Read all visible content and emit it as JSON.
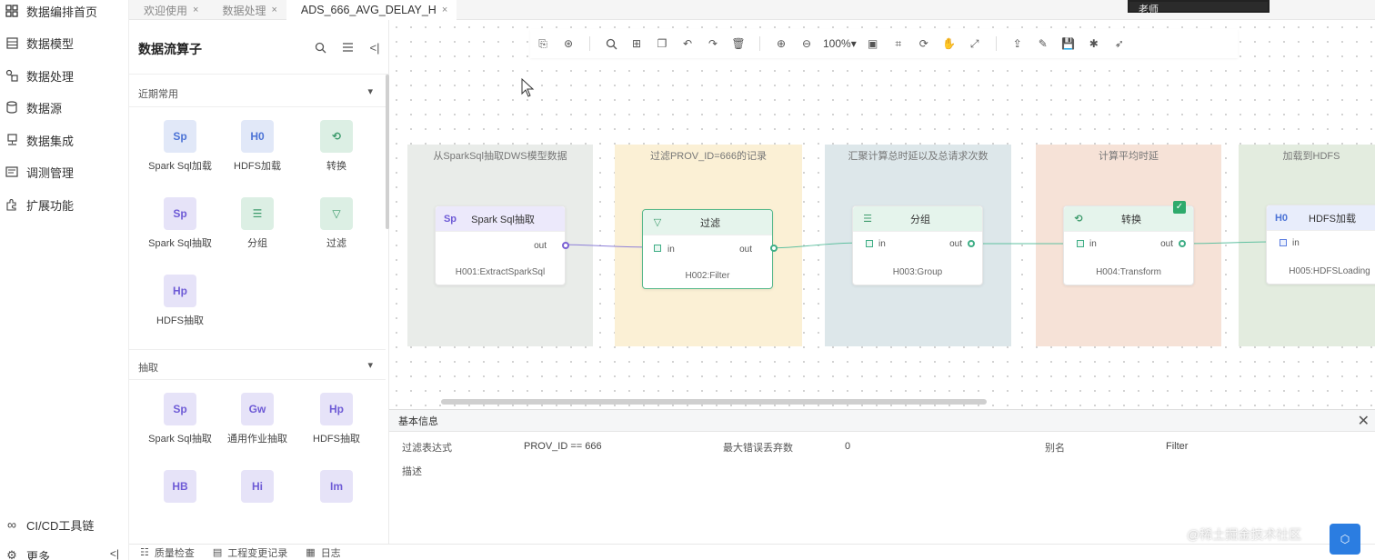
{
  "nav": {
    "items": [
      {
        "label": "数据编排首页",
        "icon": "grid-icon"
      },
      {
        "label": "数据模型",
        "icon": "model-icon"
      },
      {
        "label": "数据处理",
        "icon": "process-icon"
      },
      {
        "label": "数据源",
        "icon": "database-icon"
      },
      {
        "label": "数据集成",
        "icon": "integration-icon"
      },
      {
        "label": "调测管理",
        "icon": "debug-icon"
      },
      {
        "label": "扩展功能",
        "icon": "extension-icon"
      }
    ],
    "cicd_label": "CI/CD工具链",
    "more_label": "更多"
  },
  "tabs": [
    {
      "label": "欢迎使用",
      "active": false
    },
    {
      "label": "数据处理",
      "active": false
    },
    {
      "label": "ADS_666_AVG_DELAY_H",
      "active": true
    }
  ],
  "tab_close_glyph": "×",
  "panel": {
    "title": "数据流算子",
    "sections": [
      {
        "title": "近期常用",
        "items": [
          {
            "label": "Spark Sql加载",
            "icon_text": "Sp"
          },
          {
            "label": "HDFS加载",
            "icon_text": "H0"
          },
          {
            "label": "转换",
            "icon_text": "⟲"
          },
          {
            "label": "Spark Sql抽取",
            "icon_text": "Sp"
          },
          {
            "label": "分组",
            "icon_text": "☰"
          },
          {
            "label": "过滤",
            "icon_text": "▽"
          },
          {
            "label": "HDFS抽取",
            "icon_text": "Hp"
          }
        ]
      },
      {
        "title": "抽取",
        "items": [
          {
            "label": "Spark Sql抽取",
            "icon_text": "Sp"
          },
          {
            "label": "通用作业抽取",
            "icon_text": "Gw"
          },
          {
            "label": "HDFS抽取",
            "icon_text": "Hp"
          },
          {
            "label": "",
            "icon_text": "HB"
          },
          {
            "label": "",
            "icon_text": "Hi"
          },
          {
            "label": "",
            "icon_text": "Im"
          }
        ]
      }
    ]
  },
  "toolbar": {
    "zoom": "100%▾"
  },
  "stages": [
    {
      "title": "从SparkSql抽取DWS模型数据",
      "color": "#e9ece9"
    },
    {
      "title": "过滤PROV_ID=666的记录",
      "color": "#fbf0d5"
    },
    {
      "title": "汇聚计算总时延以及总请求次数",
      "color": "#dde7ea"
    },
    {
      "title": "计算平均时延",
      "color": "#f6e2d7"
    },
    {
      "title": "加载到HDFS",
      "color": "#e3ecdf"
    }
  ],
  "nodes": [
    {
      "title": "Spark Sql抽取",
      "icon_text": "Sp",
      "in_label": "",
      "out_label": "out",
      "id_label": "H001:ExtractSparkSql"
    },
    {
      "title": "过滤",
      "icon_text": "▽",
      "in_label": "in",
      "out_label": "out",
      "id_label": "H002:Filter"
    },
    {
      "title": "分组",
      "icon_text": "☰",
      "in_label": "in",
      "out_label": "out",
      "id_label": "H003:Group"
    },
    {
      "title": "转换",
      "icon_text": "⟲",
      "in_label": "in",
      "out_label": "out",
      "id_label": "H004:Transform"
    },
    {
      "title": "HDFS加载",
      "icon_text": "H0",
      "in_label": "in",
      "out_label": "",
      "id_label": "H005:HDFSLoading"
    }
  ],
  "props": {
    "title": "基本信息",
    "filter_expr_label": "过滤表达式",
    "filter_expr_value": "PROV_ID == 666",
    "max_error_label": "最大错误丢弃数",
    "max_error_value": "0",
    "alias_label": "别名",
    "alias_value": "Filter",
    "desc_label": "描述",
    "close_glyph": "✕"
  },
  "bottombar": {
    "items": [
      "质量检查",
      "工程变更记录",
      "日志"
    ]
  },
  "overlay": {
    "video_name": "老师",
    "watermark": "@稀土掘金技术社区"
  }
}
